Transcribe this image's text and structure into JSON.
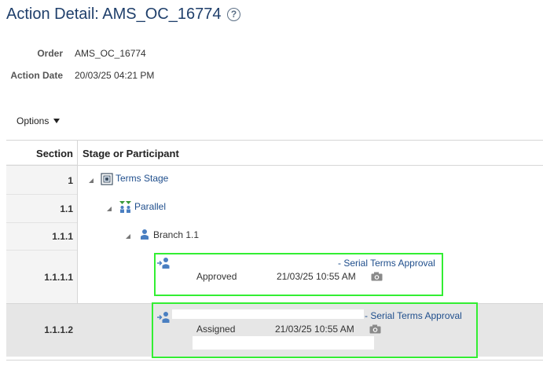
{
  "page": {
    "title": "Action Detail: AMS_OC_16774",
    "help_icon": "question-circle-icon"
  },
  "fields": {
    "order_label": "Order",
    "order_value": "AMS_OC_16774",
    "date_label": "Action Date",
    "date_value": "20/03/25 04:21 PM"
  },
  "toolbar": {
    "options_label": "Options"
  },
  "table": {
    "headers": {
      "section": "Section",
      "stage": "Stage or Participant"
    },
    "rows": [
      {
        "section": "1",
        "label": "Terms Stage",
        "icon": "stage-icon"
      },
      {
        "section": "1.1",
        "label": "Parallel",
        "icon": "parallel-icon"
      },
      {
        "section": "1.1.1",
        "label": "Branch 1.1",
        "icon": "participant-icon"
      },
      {
        "section": "1.1.1.1",
        "link": "- Serial Terms Approval",
        "status": "Approved",
        "time": "21/03/25 10:55 AM",
        "icon": "assignee-icon",
        "camera": "camera-icon"
      },
      {
        "section": "1.1.1.2",
        "link": "- Serial Terms Approval",
        "status": "Assigned",
        "time": "21/03/25 10:55 AM",
        "icon": "assignee-icon",
        "camera": "camera-icon"
      }
    ]
  },
  "colors": {
    "highlight": "#33ee33",
    "link": "#1f4e8c",
    "title": "#1f3f6b"
  }
}
